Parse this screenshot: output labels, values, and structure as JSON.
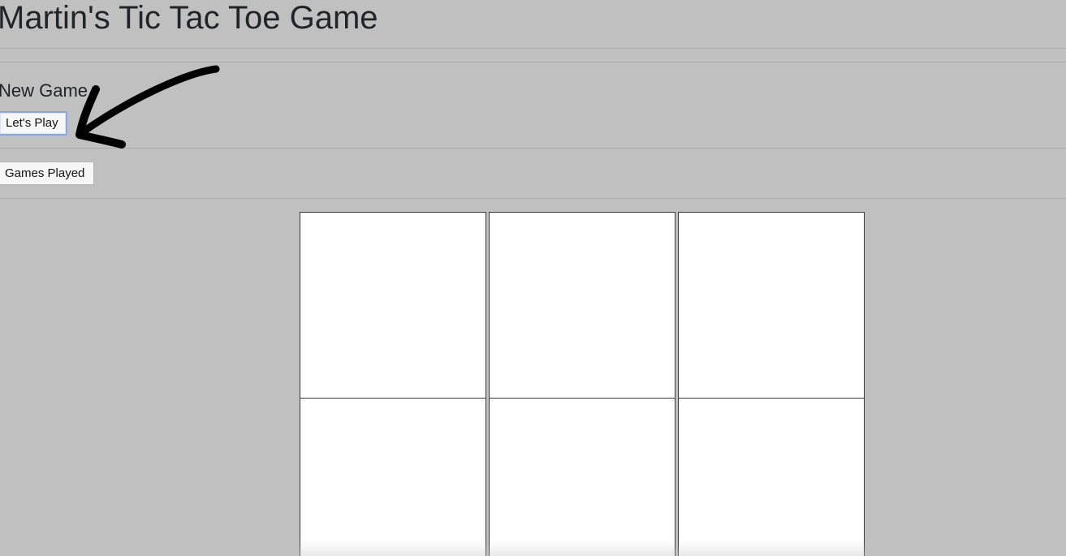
{
  "header": {
    "title": "Martin's Tic Tac Toe Game"
  },
  "new_game": {
    "heading": "New Game",
    "play_button_label": "Let's Play"
  },
  "stats": {
    "games_played_button_label": "Games Played"
  },
  "board": {
    "cells": [
      "",
      "",
      "",
      "",
      "",
      ""
    ]
  },
  "annotation": {
    "arrow_icon": "hand-drawn-arrow-icon",
    "arrow_color": "#000000"
  },
  "colors": {
    "background": "#c0c0c0",
    "cell_background": "#ffffff",
    "play_button_focus_border": "#8ea6d9"
  }
}
